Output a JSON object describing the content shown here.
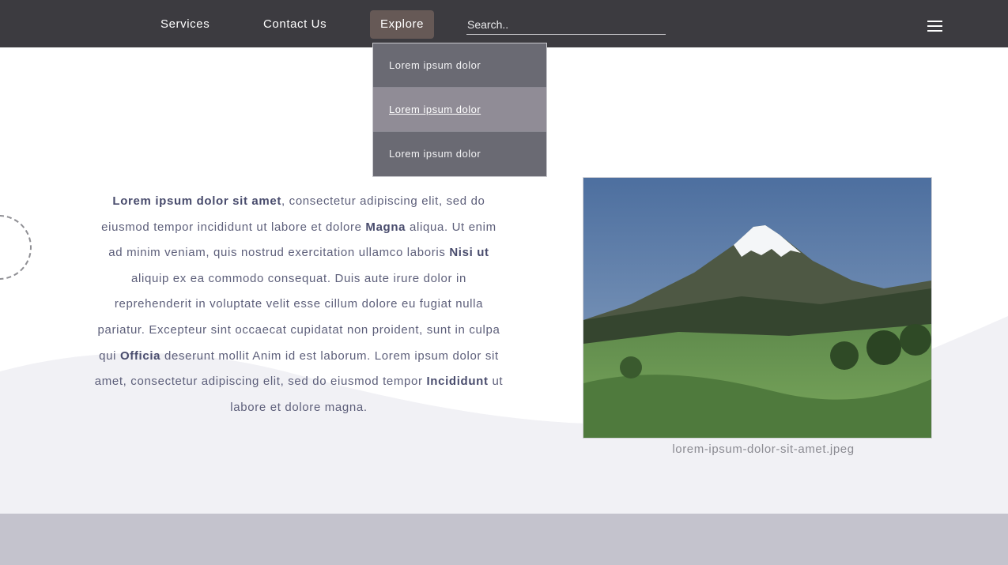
{
  "nav": {
    "items": [
      {
        "label": "Services"
      },
      {
        "label": "Contact Us"
      },
      {
        "label": "Explore"
      }
    ],
    "search_placeholder": "Search..",
    "menu_icon": "hamburger-menu-icon"
  },
  "dropdown": {
    "items": [
      {
        "label": "Lorem ipsum dolor"
      },
      {
        "label": "Lorem ipsum dolor"
      },
      {
        "label": "Lorem ipsum dolor"
      }
    ]
  },
  "content": {
    "runs": [
      {
        "text": "Lorem ipsum dolor sit amet",
        "bold": true
      },
      {
        "text": ", consectetur adipiscing elit, sed do eiusmod tempor incididunt ut labore et dolore ",
        "bold": false
      },
      {
        "text": "Magna",
        "bold": true
      },
      {
        "text": " aliqua. Ut enim ad minim veniam, quis nostrud exercitation ullamco laboris ",
        "bold": false
      },
      {
        "text": "Nisi ut",
        "bold": true
      },
      {
        "text": " aliquip ex ea commodo consequat. Duis aute irure dolor in reprehenderit in voluptate velit esse cillum dolore eu fugiat nulla pariatur. Excepteur sint occaecat cupidatat non proident, sunt in culpa qui ",
        "bold": false
      },
      {
        "text": "Officia",
        "bold": true
      },
      {
        "text": " deserunt mollit Anim id est laborum. Lorem ipsum dolor sit amet, consectetur adipiscing elit, sed do eiusmod tempor ",
        "bold": false
      },
      {
        "text": "Incididunt",
        "bold": true
      },
      {
        "text": " ut labore et dolore magna.",
        "bold": false
      }
    ]
  },
  "image": {
    "caption": "lorem-ipsum-dolor-sit-amet.jpeg"
  },
  "colors": {
    "navbar": "#3c3b40",
    "explore_active": "#665956",
    "dropdown_item": "#6a6a73",
    "dropdown_hover": "#908c96",
    "wave": "#f1f1f5",
    "footer": "#c4c3cd",
    "text": "#5d5f7a"
  }
}
